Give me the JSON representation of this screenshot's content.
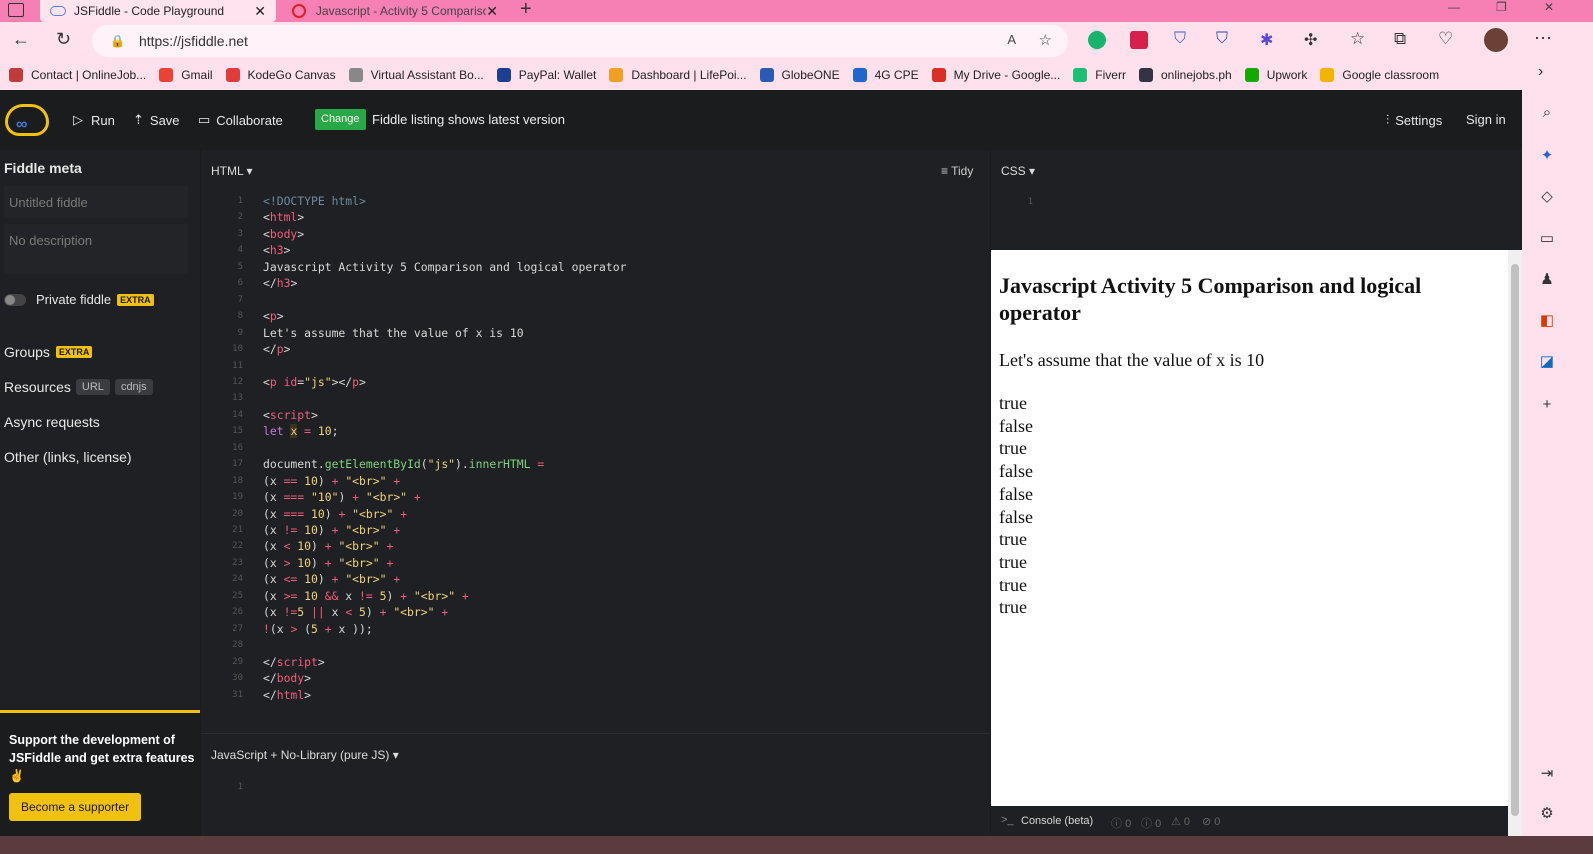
{
  "browser": {
    "tabs": [
      {
        "title": "JSFiddle - Code Playground"
      },
      {
        "title": "Javascript - Activity 5 Compariso"
      }
    ],
    "url": "https://jsfiddle.net",
    "bookmarks": [
      {
        "label": "Contact | OnlineJob...",
        "color": "#c23b3b"
      },
      {
        "label": "Gmail",
        "color": "#ea4335"
      },
      {
        "label": "KodeGo Canvas",
        "color": "#e03c3c"
      },
      {
        "label": "Virtual Assistant Bo...",
        "color": "#888"
      },
      {
        "label": "PayPal: Wallet",
        "color": "#1d3f91"
      },
      {
        "label": "Dashboard | LifePoi...",
        "color": "#f0a020"
      },
      {
        "label": "GlobeONE",
        "color": "#2a5bb5"
      },
      {
        "label": "4G CPE",
        "color": "#2266cc"
      },
      {
        "label": "My Drive - Google...",
        "color": "#d93025"
      },
      {
        "label": "Fiverr",
        "color": "#1dbf73"
      },
      {
        "label": "onlinejobs.ph",
        "color": "#334"
      },
      {
        "label": "Upwork",
        "color": "#14a800"
      },
      {
        "label": "Google classroom",
        "color": "#f4b400"
      }
    ]
  },
  "toolbar": {
    "run": "Run",
    "save": "Save",
    "collaborate": "Collaborate",
    "change_badge": "Change",
    "listing_text": "Fiddle listing shows latest version",
    "settings": "Settings",
    "signin": "Sign in"
  },
  "sidebar": {
    "meta_title": "Fiddle meta",
    "title_placeholder": "Untitled fiddle",
    "desc_placeholder": "No description",
    "private": "Private fiddle",
    "extra": "EXTRA",
    "groups": "Groups",
    "resources": "Resources",
    "url_pill": "URL",
    "cdnjs_pill": "cdnjs",
    "async": "Async requests",
    "other": "Other (links, license)",
    "support_text": "Support the development of JSFiddle and get extra features ✌",
    "support_button": "Become a supporter"
  },
  "panels": {
    "html_label": "HTML ▾",
    "tidy": "Tidy",
    "css_label": "CSS ▾",
    "js_label": "JavaScript + No-Library (pure JS) ▾",
    "css_line": "1",
    "js_line": "1"
  },
  "result": {
    "heading": "Javascript Activity 5 Comparison and logical operator",
    "para": "Let's assume that the value of x is 10",
    "values": [
      "true",
      "false",
      "true",
      "false",
      "false",
      "false",
      "true",
      "true",
      "true",
      "true"
    ]
  },
  "console": {
    "label": "Console (beta)",
    "counts": [
      "0",
      "0",
      "0",
      "0"
    ]
  }
}
